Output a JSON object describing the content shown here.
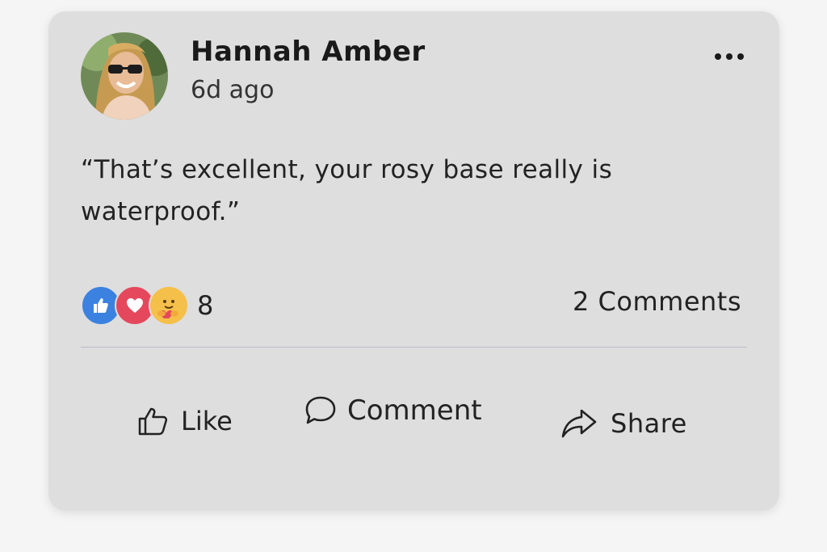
{
  "post": {
    "author": "Hannah Amber",
    "time_ago": "6d ago",
    "text": "“That’s excellent, your rosy base really is waterproof.”"
  },
  "stats": {
    "reactions": [
      "like",
      "love",
      "care"
    ],
    "reaction_count": "8",
    "comments": "2 Comments"
  },
  "actions": {
    "like": "Like",
    "comment": "Comment",
    "share": "Share"
  },
  "icons": {
    "more": "more-horizontal-icon",
    "like": "thumbs-up-icon",
    "comment": "speech-bubble-icon",
    "share": "share-arrow-icon"
  },
  "colors": {
    "card_bg": "#dedede",
    "like_blue": "#3b82e0",
    "love_red": "#e5485d",
    "care_yellow": "#f5c04a"
  }
}
